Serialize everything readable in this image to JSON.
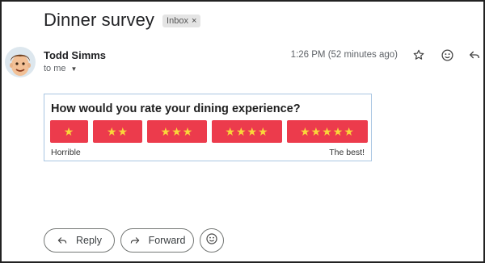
{
  "email": {
    "subject": "Dinner survey",
    "label": "Inbox",
    "label_remove_glyph": "×",
    "sender_name": "Todd Simms",
    "recipient": "to me",
    "timestamp": "1:26 PM (52 minutes ago)"
  },
  "survey": {
    "question": "How would you rate your dining experience?",
    "options": [
      {
        "stars": "★",
        "rating": 1
      },
      {
        "stars": "★★",
        "rating": 2
      },
      {
        "stars": "★★★",
        "rating": 3
      },
      {
        "stars": "★★★★",
        "rating": 4
      },
      {
        "stars": "★★★★★",
        "rating": 5
      }
    ],
    "scale_low": "Horrible",
    "scale_high": "The best!",
    "button_color": "#ec3b4c",
    "star_color": "#f9d73a"
  },
  "actions": {
    "reply_label": "Reply",
    "forward_label": "Forward",
    "icons": [
      "star-icon",
      "emoji-icon",
      "reply-icon",
      "forward-icon",
      "emoji-add-icon"
    ]
  }
}
